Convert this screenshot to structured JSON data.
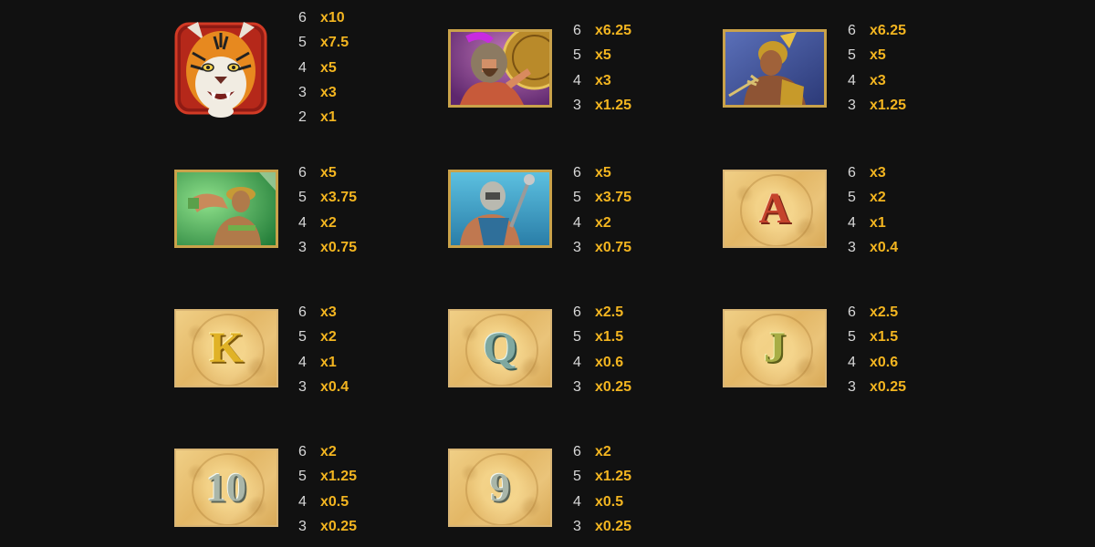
{
  "colors": {
    "background": "#111111",
    "count": "#d8d8d8",
    "multiplier": "#f3b520",
    "tile_border": "#c9a24a"
  },
  "symbols": [
    {
      "name": "tiger",
      "pays": [
        {
          "count": "6",
          "mult": "x10"
        },
        {
          "count": "5",
          "mult": "x7.5"
        },
        {
          "count": "4",
          "mult": "x5"
        },
        {
          "count": "3",
          "mult": "x3"
        },
        {
          "count": "2",
          "mult": "x1"
        }
      ]
    },
    {
      "name": "spartan-warrior",
      "pays": [
        {
          "count": "6",
          "mult": "x6.25"
        },
        {
          "count": "5",
          "mult": "x5"
        },
        {
          "count": "4",
          "mult": "x3"
        },
        {
          "count": "3",
          "mult": "x1.25"
        }
      ]
    },
    {
      "name": "trident-gladiator",
      "pays": [
        {
          "count": "6",
          "mult": "x6.25"
        },
        {
          "count": "5",
          "mult": "x5"
        },
        {
          "count": "4",
          "mult": "x3"
        },
        {
          "count": "3",
          "mult": "x1.25"
        }
      ]
    },
    {
      "name": "green-gladiator",
      "pays": [
        {
          "count": "6",
          "mult": "x5"
        },
        {
          "count": "5",
          "mult": "x3.75"
        },
        {
          "count": "4",
          "mult": "x2"
        },
        {
          "count": "3",
          "mult": "x0.75"
        }
      ]
    },
    {
      "name": "blue-gladiator",
      "pays": [
        {
          "count": "6",
          "mult": "x5"
        },
        {
          "count": "5",
          "mult": "x3.75"
        },
        {
          "count": "4",
          "mult": "x2"
        },
        {
          "count": "3",
          "mult": "x0.75"
        }
      ]
    },
    {
      "name": "A",
      "letter": "A",
      "pays": [
        {
          "count": "6",
          "mult": "x3"
        },
        {
          "count": "5",
          "mult": "x2"
        },
        {
          "count": "4",
          "mult": "x1"
        },
        {
          "count": "3",
          "mult": "x0.4"
        }
      ]
    },
    {
      "name": "K",
      "letter": "K",
      "pays": [
        {
          "count": "6",
          "mult": "x3"
        },
        {
          "count": "5",
          "mult": "x2"
        },
        {
          "count": "4",
          "mult": "x1"
        },
        {
          "count": "3",
          "mult": "x0.4"
        }
      ]
    },
    {
      "name": "Q",
      "letter": "Q",
      "pays": [
        {
          "count": "6",
          "mult": "x2.5"
        },
        {
          "count": "5",
          "mult": "x1.5"
        },
        {
          "count": "4",
          "mult": "x0.6"
        },
        {
          "count": "3",
          "mult": "x0.25"
        }
      ]
    },
    {
      "name": "J",
      "letter": "J",
      "pays": [
        {
          "count": "6",
          "mult": "x2.5"
        },
        {
          "count": "5",
          "mult": "x1.5"
        },
        {
          "count": "4",
          "mult": "x0.6"
        },
        {
          "count": "3",
          "mult": "x0.25"
        }
      ]
    },
    {
      "name": "10",
      "letter": "10",
      "pays": [
        {
          "count": "6",
          "mult": "x2"
        },
        {
          "count": "5",
          "mult": "x1.25"
        },
        {
          "count": "4",
          "mult": "x0.5"
        },
        {
          "count": "3",
          "mult": "x0.25"
        }
      ]
    },
    {
      "name": "9",
      "letter": "9",
      "pays": [
        {
          "count": "6",
          "mult": "x2"
        },
        {
          "count": "5",
          "mult": "x1.25"
        },
        {
          "count": "4",
          "mult": "x0.5"
        },
        {
          "count": "3",
          "mult": "x0.25"
        }
      ]
    }
  ]
}
